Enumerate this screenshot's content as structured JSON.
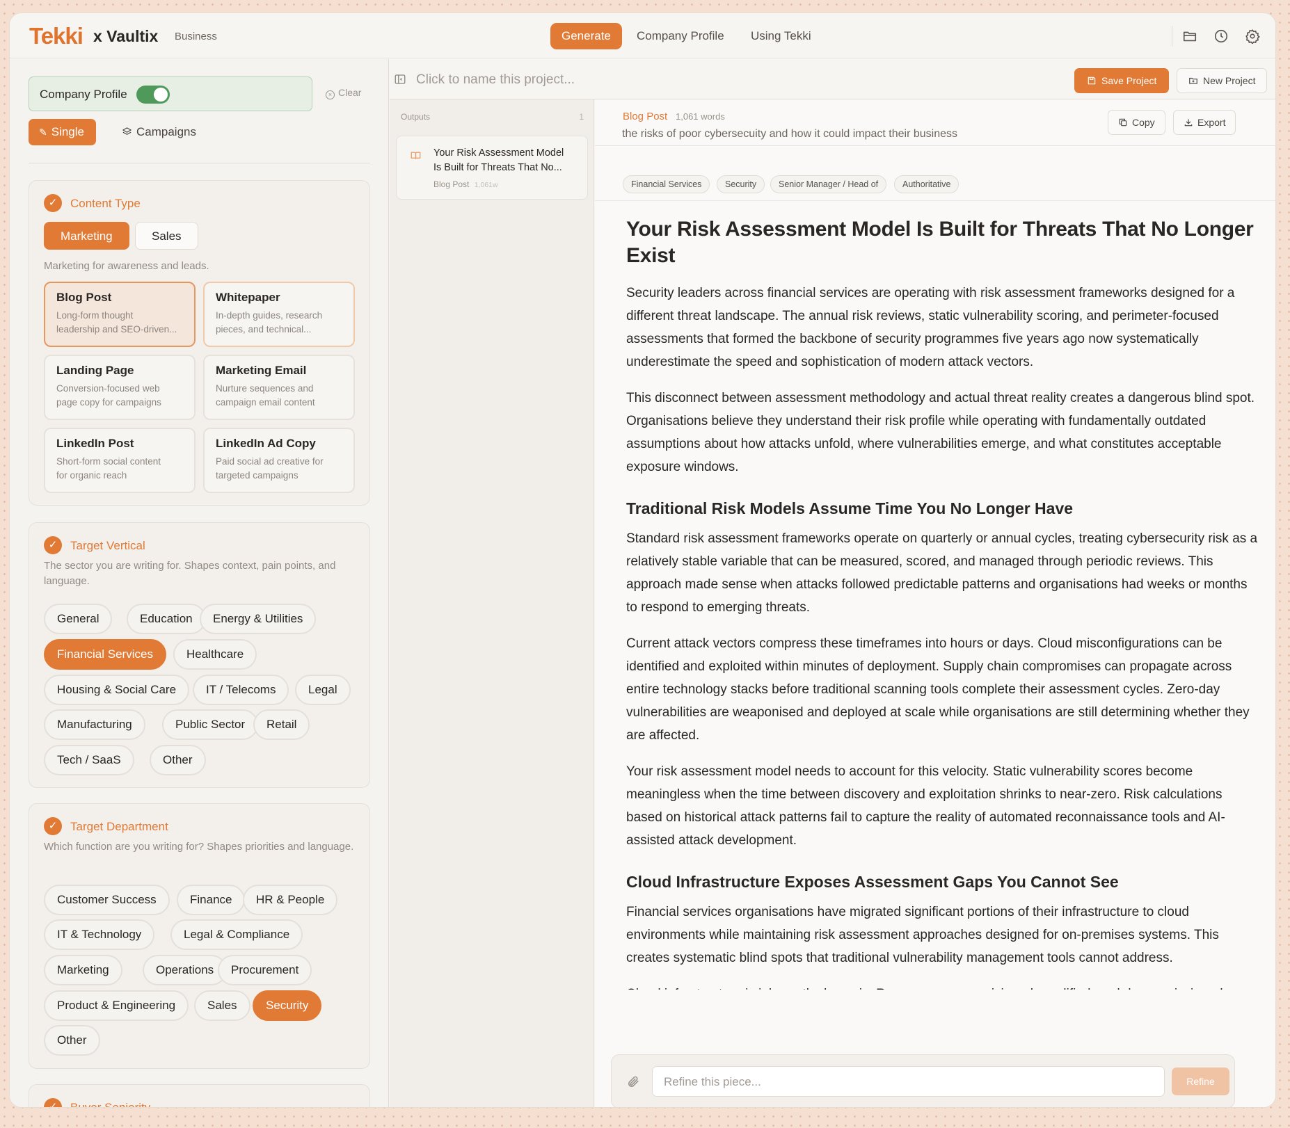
{
  "header": {
    "logo": "Tekki",
    "partner": "x Vaultix",
    "plan": "Business",
    "nav": [
      "Generate",
      "Company Profile",
      "Using Tekki"
    ]
  },
  "sidebar": {
    "toggle_label": "Company Profile",
    "toggle_on": true,
    "clear": "Clear",
    "modes": [
      "Single",
      "Campaigns"
    ],
    "content_type": {
      "title": "Content Type",
      "tabs": [
        "Marketing",
        "Sales"
      ],
      "description": "Marketing for awareness and leads.",
      "cards": [
        {
          "title": "Blog Post",
          "desc1": "Long-form thought",
          "desc2": "leadership and SEO-driven..."
        },
        {
          "title": "Whitepaper",
          "desc1": "In-depth guides, research",
          "desc2": "pieces, and technical..."
        },
        {
          "title": "Landing Page",
          "desc1": "Conversion-focused web",
          "desc2": "page copy for campaigns"
        },
        {
          "title": "Marketing Email",
          "desc1": "Nurture sequences and",
          "desc2": "campaign email content"
        },
        {
          "title": "LinkedIn Post",
          "desc1": "Short-form social content",
          "desc2": "for organic reach"
        },
        {
          "title": "LinkedIn Ad Copy",
          "desc1": "Paid social ad creative for",
          "desc2": "targeted campaigns"
        }
      ]
    },
    "target_vertical": {
      "title": "Target Vertical",
      "description": "The sector you are writing for. Shapes context, pain points, and language.",
      "chips": [
        "General",
        "Education",
        "Energy & Utilities",
        "Financial Services",
        "Healthcare",
        "Housing & Social Care",
        "IT / Telecoms",
        "Legal",
        "Manufacturing",
        "Public Sector",
        "Retail",
        "Tech / SaaS",
        "Other"
      ]
    },
    "target_department": {
      "title": "Target Department",
      "description": "Which function are you writing for? Shapes priorities and language.",
      "chips": [
        "Customer Success",
        "Finance",
        "HR & People",
        "IT & Technology",
        "Legal & Compliance",
        "Marketing",
        "Operations",
        "Procurement",
        "Product & Engineering",
        "Sales",
        "Security",
        "Other"
      ]
    },
    "buyer_seniority": {
      "title": "Buyer Seniority"
    }
  },
  "project": {
    "name_placeholder": "Click to name this project...",
    "save": "Save Project",
    "new": "New Project"
  },
  "outputs": {
    "label": "Outputs",
    "count": "1",
    "items": [
      {
        "title1": "Your Risk Assessment Model",
        "title2": "Is Built for Threats That No...",
        "type": "Blog Post",
        "words": "1,061w"
      }
    ]
  },
  "doc": {
    "type": "Blog Post",
    "words": "1,061 words",
    "brief": "the risks of poor cybersecuity and how it could impact their business",
    "copy": "Copy",
    "export": "Export",
    "tags": [
      "Financial Services",
      "Security",
      "Senior Manager / Head of",
      "Authoritative"
    ],
    "title": "Your Risk Assessment Model Is Built for Threats That No Longer Exist",
    "p1": "Security leaders across financial services are operating with risk assessment frameworks designed for a different threat landscape. The annual risk reviews, static vulnerability scoring, and perimeter-focused assessments that formed the backbone of security programmes five years ago now systematically underestimate the speed and sophistication of modern attack vectors.",
    "p2": "This disconnect between assessment methodology and actual threat reality creates a dangerous blind spot. Organisations believe they understand their risk profile while operating with fundamentally outdated assumptions about how attacks unfold, where vulnerabilities emerge, and what constitutes acceptable exposure windows.",
    "h2a": "Traditional Risk Models Assume Time You No Longer Have",
    "p3": "Standard risk assessment frameworks operate on quarterly or annual cycles, treating cybersecurity risk as a relatively stable variable that can be measured, scored, and managed through periodic reviews. This approach made sense when attacks followed predictable patterns and organisations had weeks or months to respond to emerging threats.",
    "p4": "Current attack vectors compress these timeframes into hours or days. Cloud misconfigurations can be identified and exploited within minutes of deployment. Supply chain compromises can propagate across entire technology stacks before traditional scanning tools complete their assessment cycles. Zero-day vulnerabilities are weaponised and deployed at scale while organisations are still determining whether they are affected.",
    "p5": "Your risk assessment model needs to account for this velocity. Static vulnerability scores become meaningless when the time between discovery and exploitation shrinks to near-zero. Risk calculations based on historical attack patterns fail to capture the reality of automated reconnaissance tools and AI-assisted attack development.",
    "h2b": "Cloud Infrastructure Exposes Assessment Gaps You Cannot See",
    "p6": "Financial services organisations have migrated significant portions of their infrastructure to cloud environments while maintaining risk assessment approaches designed for on-premises systems. This creates systematic blind spots that traditional vulnerability management tools cannot address.",
    "p7": "Cloud infrastructure is inherently dynamic. Resources are provisioned, modified, and decommissioned continuously. Access permissions change as development teams deploy new services. Network configurations shift as workloads scale. Traditional risk assessments capture"
  },
  "refine": {
    "placeholder": "Refine this piece...",
    "button": "Refine"
  },
  "colors": {
    "accent": "#e07a35",
    "toggle": "#4f9a5a"
  }
}
